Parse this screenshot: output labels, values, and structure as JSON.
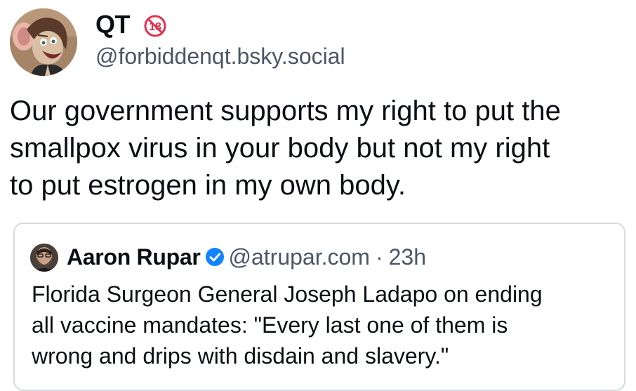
{
  "post": {
    "author": {
      "display_name": "QT",
      "handle": "@forbiddenqt.bsky.social",
      "adult_badge_label": "18"
    },
    "text": "Our government supports my right to put the\nsmallpox virus in your body but not my right\nto put estrogen in my own body."
  },
  "quote": {
    "author": {
      "display_name": "Aaron Rupar",
      "handle": "@atrupar.com",
      "separator": "·",
      "time": "23h"
    },
    "text": "Florida Surgeon General Joseph Ladapo on ending\nall vaccine mandates: \"Every last one of them is\nwrong and drips with disdain and slavery.\""
  },
  "colors": {
    "text": "#0b0f14",
    "muted": "#4a5664",
    "card_border": "#d4dbe2",
    "verified_blue": "#1083fe",
    "adult_badge_red": "#e0324e"
  },
  "icons": {
    "author_avatar": "cartoon-rat-avatar",
    "adult_badge": "18-plus-badge-icon",
    "verified": "verified-check-icon"
  }
}
